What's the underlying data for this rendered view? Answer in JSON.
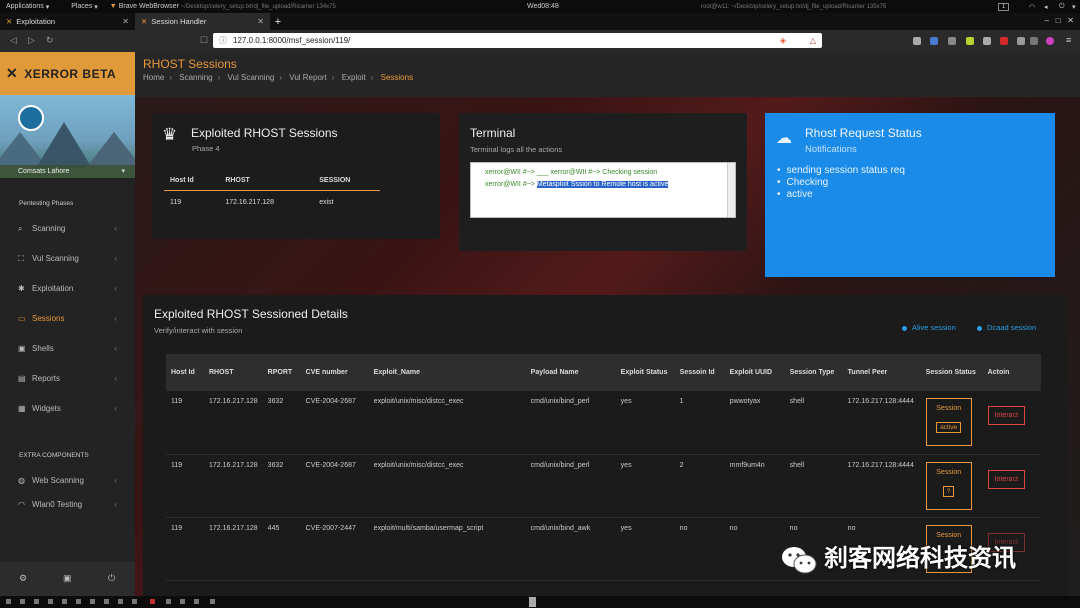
{
  "system_bar": {
    "applications": "Applications",
    "places": "Places",
    "browser": "Brave WebBrowser",
    "faded_title": "~/Desktop/celery_setup.txt/dj_file_upload/Ricamer 134x75",
    "clock": "Wed08:48",
    "terminal_title": "root@w11: ~/Desktop/celery_setup.txt/dj_file_upload/Ricamer 135x75",
    "workspace": "1"
  },
  "browser_tabs": [
    {
      "label": "Exploitation"
    },
    {
      "label": "Session Handler"
    }
  ],
  "address": {
    "url": "127.0.0.1:8000/msf_session/119/"
  },
  "brand": {
    "name": "XERROR BETA"
  },
  "org": {
    "name": "Comsats Lahore"
  },
  "sidebar": {
    "section1": "Pentesting Phases",
    "items": [
      {
        "label": "Scanning",
        "icon": "search-icon"
      },
      {
        "label": "Vul Scanning",
        "icon": "scan-icon"
      },
      {
        "label": "Exploitation",
        "icon": "bug-icon"
      },
      {
        "label": "Sessions",
        "icon": "laptop-icon"
      },
      {
        "label": "Shells",
        "icon": "terminal-icon"
      },
      {
        "label": "Reports",
        "icon": "document-icon"
      },
      {
        "label": "Widgets",
        "icon": "grid-icon"
      }
    ],
    "section2": "EXTRA COMPONENTS",
    "extra_items": [
      {
        "label": "Web Scanning",
        "icon": "globe-icon"
      },
      {
        "label": "Wlan0 Testing",
        "icon": "wifi-icon"
      }
    ]
  },
  "page": {
    "title": "RHOST Sessions",
    "breadcrumb": [
      "Home",
      "Scanning",
      "Vul Scanning",
      "Vul Report",
      "Exploit",
      "Sessions"
    ]
  },
  "exploited_card": {
    "title": "Exploited RHOST Sessions",
    "subtitle": "Phase 4",
    "headers": [
      "Host Id",
      "RHOST",
      "SESSION"
    ],
    "rows": [
      [
        "119",
        "172.16.217.128",
        "exist"
      ]
    ]
  },
  "terminal_card": {
    "title": "Terminal",
    "subtitle": "Terminal logs all the actions",
    "line1": "xerror@WII #~> ___ xerror@WII #~> Checking session",
    "line2_prefix": "xerror@WII #~> ",
    "line2_highlight": "Metasploit Sssion to Remote host is active"
  },
  "status_card": {
    "title": "Rhost Request Status",
    "subtitle": "Notifications",
    "items": [
      "sending session status req",
      "Checking",
      "active"
    ],
    "color": "#1a8be8"
  },
  "details_card": {
    "title": "Exploited RHOST Sessioned Details",
    "subtitle": "Verify/interact with session",
    "legend_alive": "Alive session",
    "legend_dead": "Dcaad session",
    "headers": [
      "Host Id",
      "RHOST",
      "RPORT",
      "CVE number",
      "Exploit_Name",
      "Payload Name",
      "Exploit Status",
      "Sessoin Id",
      "Exploit UUID",
      "Session Type",
      "Tunnel Peer",
      "Session Status",
      "Actoin"
    ],
    "rows": [
      {
        "host_id": "119",
        "rhost": "172.16.217.128",
        "rport": "3632",
        "cve": "CVE-2004-2687",
        "exploit": "exploit/unix/misc/distcc_exec",
        "payload": "cmd/unix/bind_perl",
        "exploit_status": "yes",
        "session_id": "1",
        "uuid": "pwwotyax",
        "type": "shell",
        "peer": "172.16.217.128:4444",
        "session_label": "Session",
        "session_state": "active",
        "action": "Interact"
      },
      {
        "host_id": "119",
        "rhost": "172.16.217.128",
        "rport": "3632",
        "cve": "CVE-2004-2687",
        "exploit": "exploit/unix/misc/distcc_exec",
        "payload": "cmd/unix/bind_perl",
        "exploit_status": "yes",
        "session_id": "2",
        "uuid": "mmf9um4n",
        "type": "shell",
        "peer": "172.16.217.128:4444",
        "session_label": "Session",
        "session_state": "?",
        "action": "Interact"
      },
      {
        "host_id": "119",
        "rhost": "172.16.217.128",
        "rport": "445",
        "cve": "CVE-2007-2447",
        "exploit": "exploit/multi/samba/usermap_script",
        "payload": "cmd/unix/bind_awk",
        "exploit_status": "yes",
        "session_id": "no",
        "uuid": "no",
        "type": "no",
        "peer": "no",
        "session_label": "Session",
        "session_state": "",
        "action": "Interact"
      }
    ]
  },
  "watermark": {
    "text": "刹客网络科技资讯"
  },
  "accent": "#e8973a"
}
